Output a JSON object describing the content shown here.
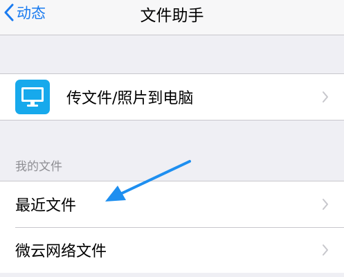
{
  "nav": {
    "back_label": "动态",
    "title": "文件助手"
  },
  "transfer_row": {
    "icon": "monitor-icon",
    "label": "传文件/照片到电脑"
  },
  "my_files": {
    "header": "我的文件",
    "items": [
      {
        "label": "最近文件"
      },
      {
        "label": "微云网络文件"
      }
    ]
  },
  "colors": {
    "accent": "#1a7bf0",
    "icon_bg": "#17a9ec",
    "background": "#efeff4",
    "separator": "#c8c7cc",
    "chevron": "#c7c7cc",
    "section_text": "#8e8e93",
    "annotation_arrow": "#1e8ff0"
  }
}
